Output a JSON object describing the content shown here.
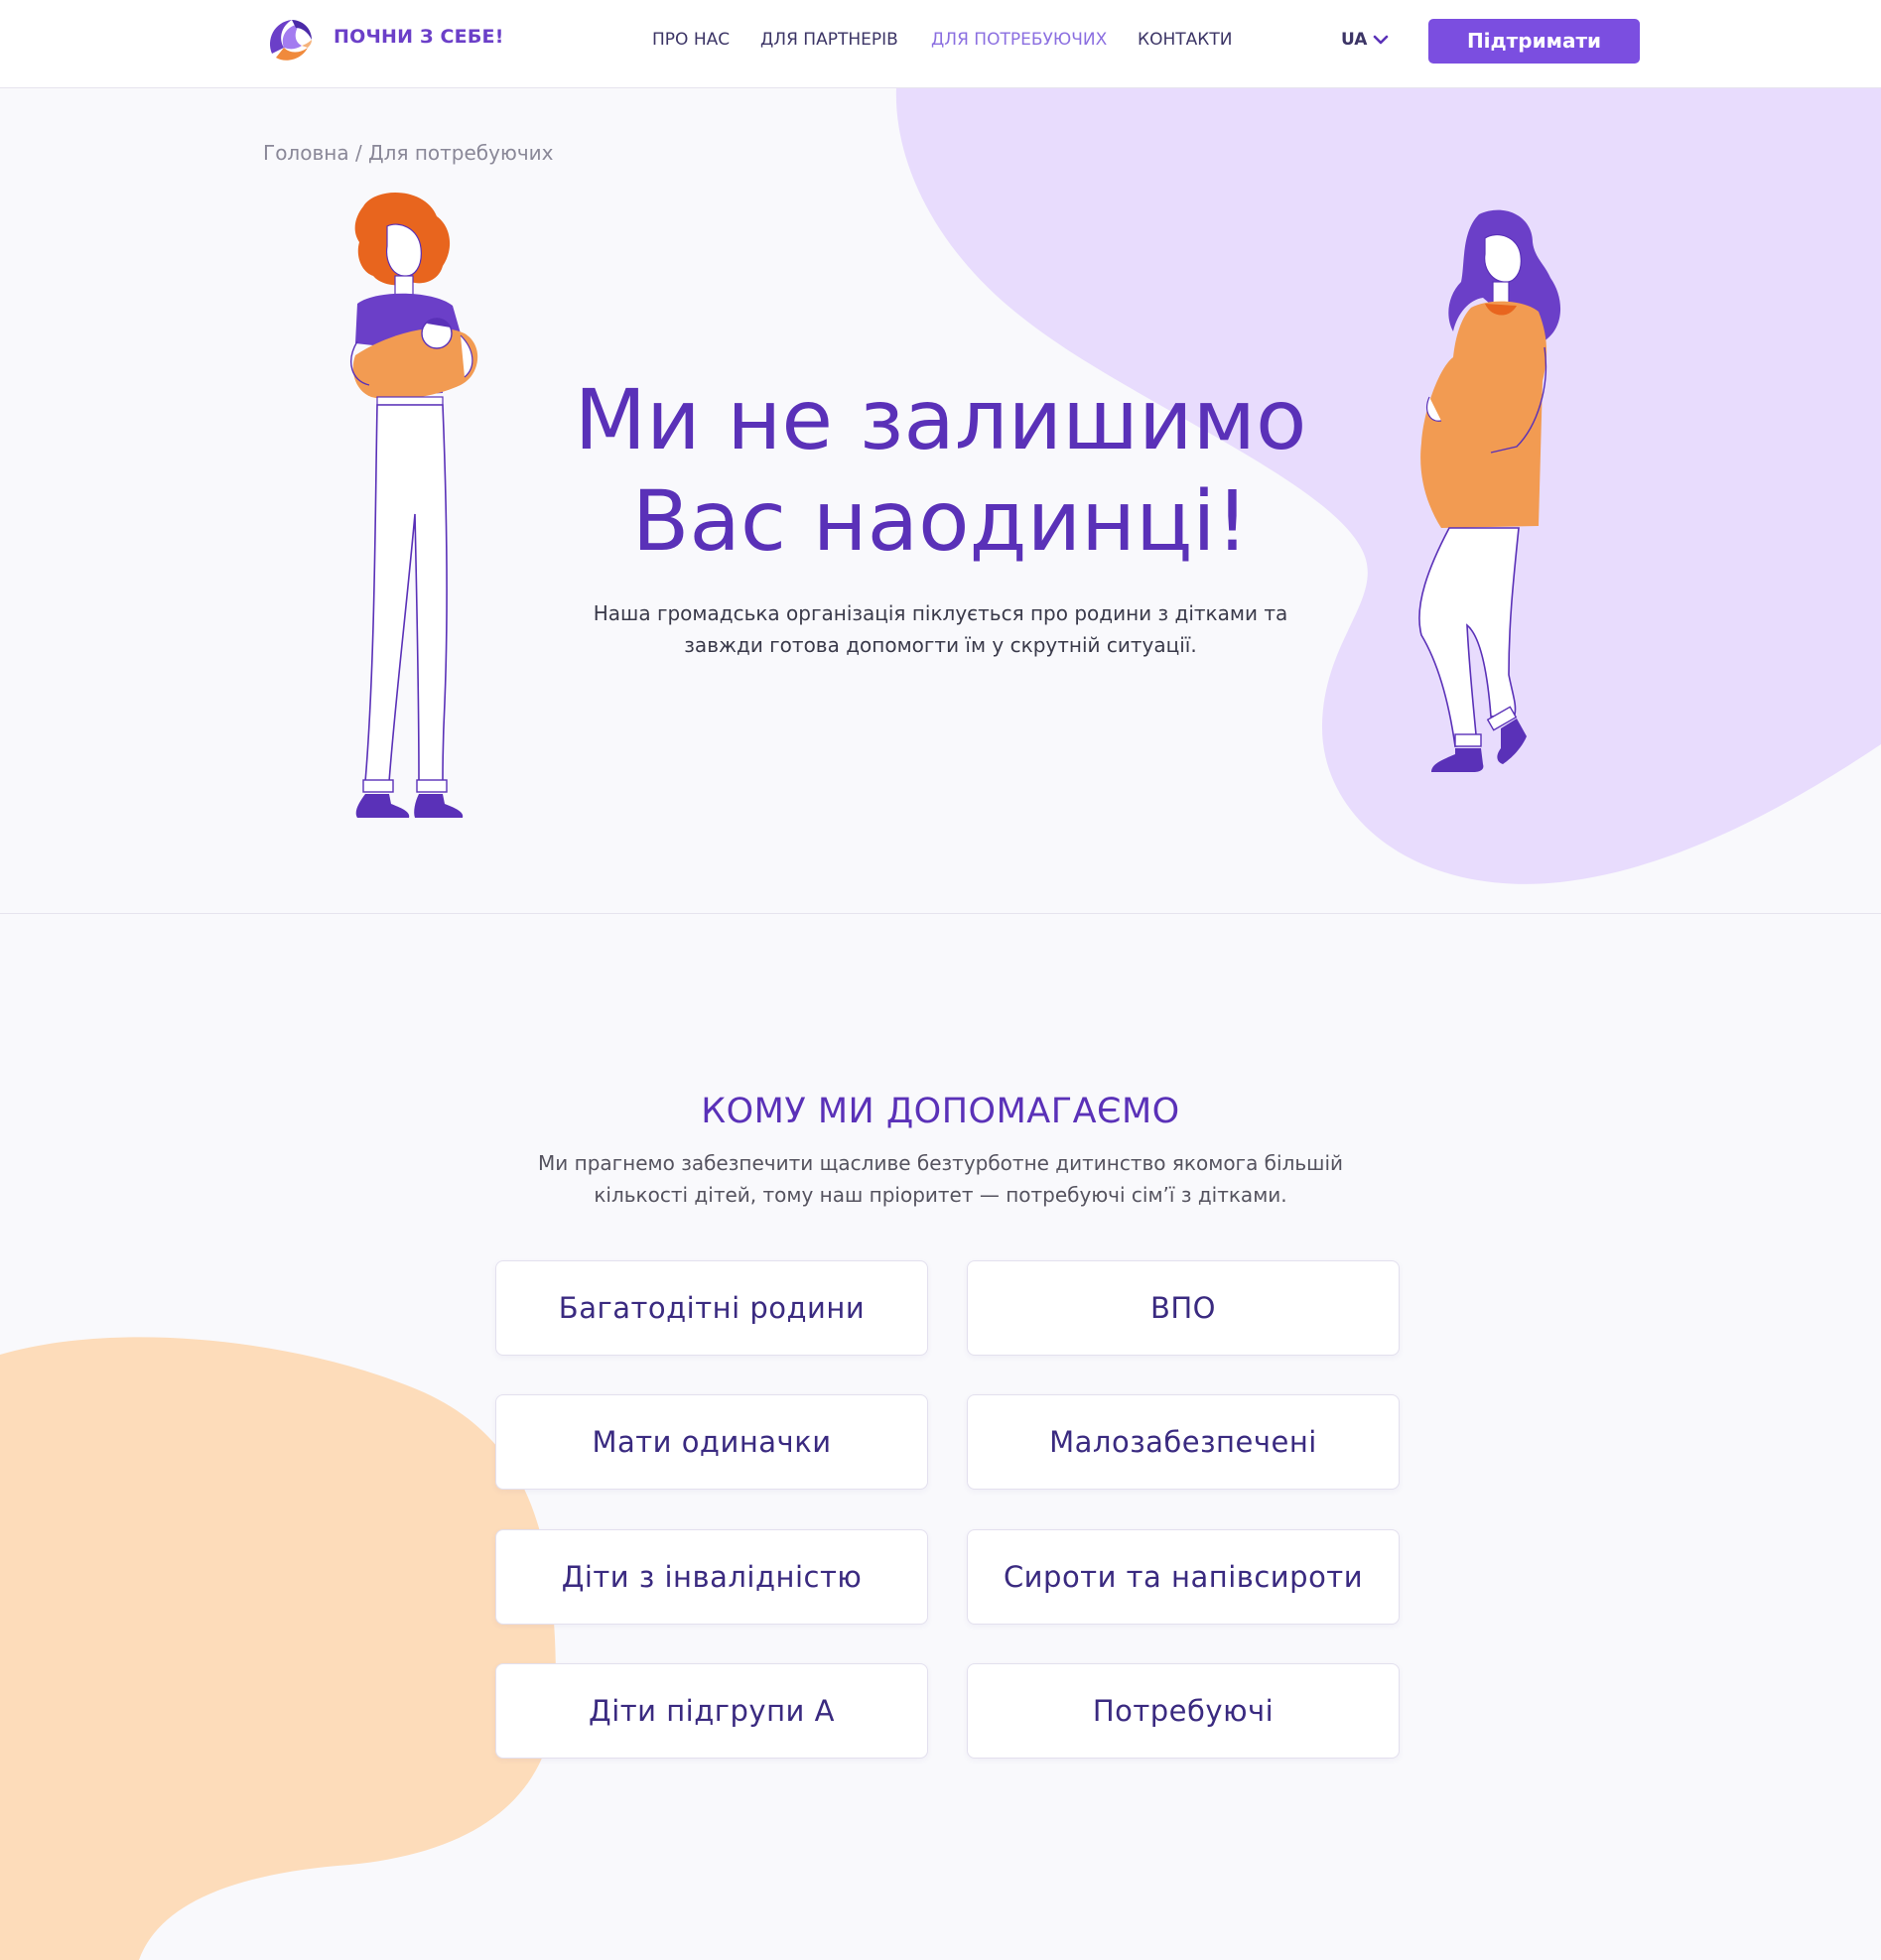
{
  "header": {
    "logo_text": "ПОЧНИ З СЕБЕ!",
    "nav": [
      "ПРО НАС",
      "ДЛЯ ПАРТНЕРІВ",
      "ДЛЯ ПОТРЕБУЮЧИХ",
      "КОНТАКТИ"
    ],
    "active_nav": "ДЛЯ ПОТРЕБУЮЧИХ",
    "lang": "UA",
    "support_label": "Підтримати"
  },
  "breadcrumb": {
    "home": "Головна",
    "separator": "/",
    "current": "Для потребуючих"
  },
  "hero": {
    "title_line1": "Ми не залишимо",
    "title_line2": "Вас наодинці!",
    "subtitle_line1": "Наша громадська організація піклується про родини з дітками та",
    "subtitle_line2": "завжди готова допомогти їм у скрутній ситуації."
  },
  "help": {
    "title": "КОМУ МИ ДОПОМАГАЄМО",
    "subtitle_line1": "Ми прагнемо забезпечити щасливе безтурботне дитинство якомога більшій",
    "subtitle_line2": "кількості дітей, тому наш пріоритет — потребуючі сім’ї з дітками.",
    "categories": [
      "Багатодітні родини",
      "ВПО",
      "Мати одиначки",
      "Малозабезпечені",
      "Діти з інвалідністю",
      "Сироти та напівсироти",
      "Діти підгрупи А",
      "Потребуючі"
    ]
  },
  "colors": {
    "accent": "#7b4ee0",
    "title_purple": "#5a31b8",
    "lavender_blob": "#e8dcfd",
    "peach_blob": "#fddcba",
    "orange": "#f29b52",
    "hair_orange": "#e8651e"
  },
  "icons": [
    "logo-icon",
    "chevron-down-icon"
  ]
}
